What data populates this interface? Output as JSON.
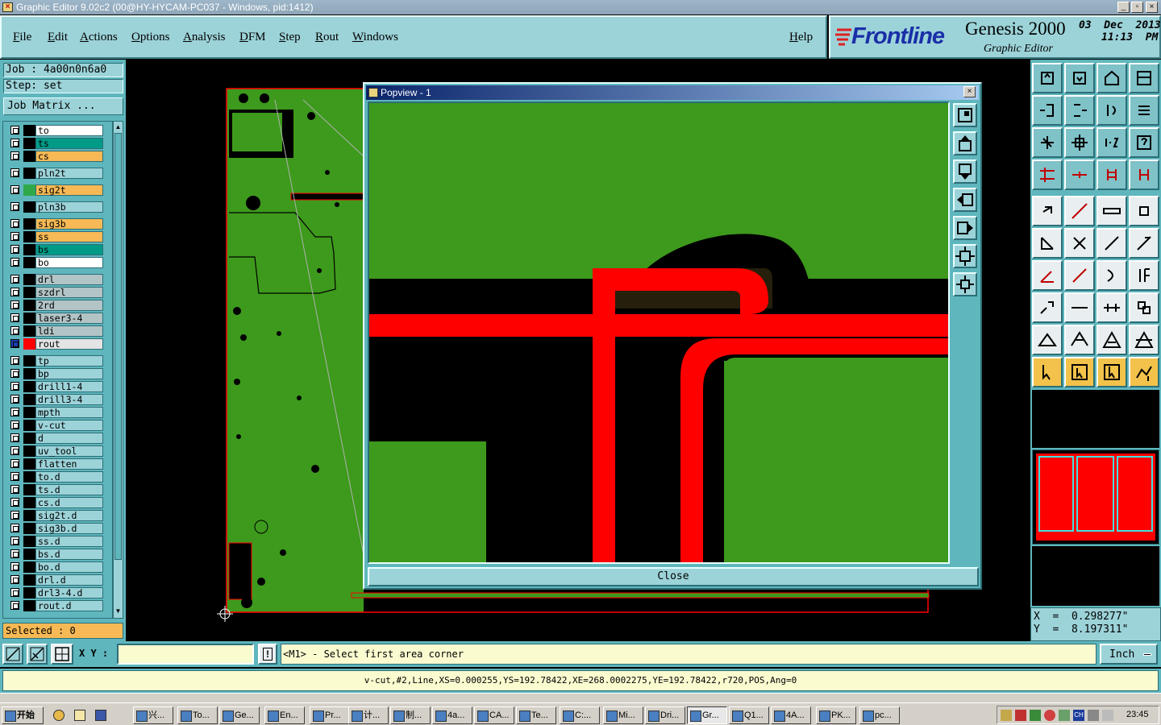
{
  "window": {
    "title": "Graphic Editor 9.02c2 (00@HY-HYCAM-PC037 - Windows, pid:1412)"
  },
  "menu": {
    "items": [
      "File",
      "Edit",
      "Actions",
      "Options",
      "Analysis",
      "DFM",
      "Step",
      "Rout",
      "Windows"
    ],
    "help": "Help"
  },
  "brand": {
    "logo": "Frontline",
    "product": "Genesis 2000",
    "subtitle": "Graphic Editor",
    "date": "03  Dec  2013",
    "time": "11:13  PM"
  },
  "job": {
    "job_line": "Job : 4a00n0n6a0",
    "step_line": "Step: set",
    "matrix_button": "Job Matrix ..."
  },
  "layers": [
    {
      "name": "to",
      "color": "#ffffff",
      "swatch": ""
    },
    {
      "name": "ts",
      "color": "#009b87",
      "swatch": ""
    },
    {
      "name": "cs",
      "color": "#f7b955",
      "swatch": ""
    },
    {
      "name": "pln2t",
      "color": "#9cd3d9",
      "swatch": ""
    },
    {
      "name": "sig2t",
      "color": "#f7b955",
      "swatch": "#2ea84a"
    },
    {
      "name": "pln3b",
      "color": "#9cd3d9",
      "swatch": ""
    },
    {
      "name": "sig3b",
      "color": "#f7b955",
      "swatch": ""
    },
    {
      "name": "ss",
      "color": "#f7b955",
      "swatch": ""
    },
    {
      "name": "bs",
      "color": "#009b87",
      "swatch": ""
    },
    {
      "name": "bo",
      "color": "#ffffff",
      "swatch": ""
    },
    {
      "name": "drl",
      "color": "#b2c4c6",
      "swatch": ""
    },
    {
      "name": "szdrl",
      "color": "#b2c4c6",
      "swatch": ""
    },
    {
      "name": "2rd",
      "color": "#b2c4c6",
      "swatch": ""
    },
    {
      "name": "laser3-4",
      "color": "#b2c4c6",
      "swatch": ""
    },
    {
      "name": "ldi",
      "color": "#b2c4c6",
      "swatch": ""
    },
    {
      "name": "rout",
      "color": "#e4e4e4",
      "swatch": "#ff0000"
    },
    {
      "name": "tp",
      "color": "#9cd3d9",
      "swatch": ""
    },
    {
      "name": "bp",
      "color": "#9cd3d9",
      "swatch": ""
    },
    {
      "name": "drill1-4",
      "color": "#9cd3d9",
      "swatch": ""
    },
    {
      "name": "drill3-4",
      "color": "#9cd3d9",
      "swatch": ""
    },
    {
      "name": "mpth",
      "color": "#9cd3d9",
      "swatch": ""
    },
    {
      "name": "v-cut",
      "color": "#9cd3d9",
      "swatch": ""
    },
    {
      "name": "d",
      "color": "#9cd3d9",
      "swatch": ""
    },
    {
      "name": "uv_tool",
      "color": "#9cd3d9",
      "swatch": ""
    },
    {
      "name": "flatten",
      "color": "#9cd3d9",
      "swatch": ""
    },
    {
      "name": "to.d",
      "color": "#9cd3d9",
      "swatch": ""
    },
    {
      "name": "ts.d",
      "color": "#9cd3d9",
      "swatch": ""
    },
    {
      "name": "cs.d",
      "color": "#9cd3d9",
      "swatch": ""
    },
    {
      "name": "sig2t.d",
      "color": "#9cd3d9",
      "swatch": ""
    },
    {
      "name": "sig3b.d",
      "color": "#9cd3d9",
      "swatch": ""
    },
    {
      "name": "ss.d",
      "color": "#9cd3d9",
      "swatch": ""
    },
    {
      "name": "bs.d",
      "color": "#9cd3d9",
      "swatch": ""
    },
    {
      "name": "bo.d",
      "color": "#9cd3d9",
      "swatch": ""
    },
    {
      "name": "drl.d",
      "color": "#9cd3d9",
      "swatch": ""
    },
    {
      "name": "drl3-4.d",
      "color": "#9cd3d9",
      "swatch": ""
    },
    {
      "name": "rout.d",
      "color": "#9cd3d9",
      "swatch": ""
    }
  ],
  "selected": "Selected : 0",
  "popview": {
    "title": "Popview - 1",
    "close": "Close"
  },
  "coords": {
    "x": "X  =  0.298277\"",
    "y": "Y  =  8.197311\""
  },
  "cmd": {
    "xy_label": "X Y :",
    "xy_value": "",
    "bang": "!",
    "prompt": "<M1> - Select first area corner",
    "units": "Inch"
  },
  "status": {
    "text": "v-cut,#2,Line,XS=0.000255,YS=192.78422,XE=268.0002275,YE=192.78422,r720,POS,Ang=0"
  },
  "taskbar": {
    "start": "开始",
    "tasks": [
      "兴...",
      "To...",
      "Ge...",
      "En...",
      "Pr...",
      "计...",
      "制...",
      "4a...",
      "CA...",
      "Te...",
      "C:...",
      "Mi...",
      "Dri...",
      "Gr...",
      "Q1...",
      "4A...",
      "PK...",
      "pc..."
    ],
    "clock": "23:45"
  }
}
